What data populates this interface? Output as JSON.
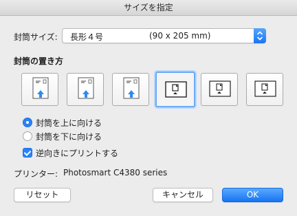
{
  "window": {
    "title": "サイズを指定"
  },
  "envelope_size": {
    "label": "封筒サイズ:",
    "selected_name": "長形４号",
    "selected_dims": "(90 x 205 mm)"
  },
  "orientation": {
    "heading": "封筒の置き方",
    "options": [
      "option-1",
      "option-2",
      "option-3",
      "option-4",
      "option-5",
      "option-6"
    ],
    "selected_index": 3
  },
  "facing": {
    "up_label": "封筒を上に向ける",
    "down_label": "封筒を下に向ける",
    "selected": "up"
  },
  "reverse": {
    "label": "逆向きにプリントする",
    "checked": true
  },
  "printer": {
    "label": "プリンター:",
    "name": "Photosmart C4380 series"
  },
  "buttons": {
    "reset": "リセット",
    "cancel": "キャンセル",
    "ok": "OK"
  },
  "colors": {
    "accent": "#2a82f7",
    "arrow": "#2d8bf0"
  }
}
